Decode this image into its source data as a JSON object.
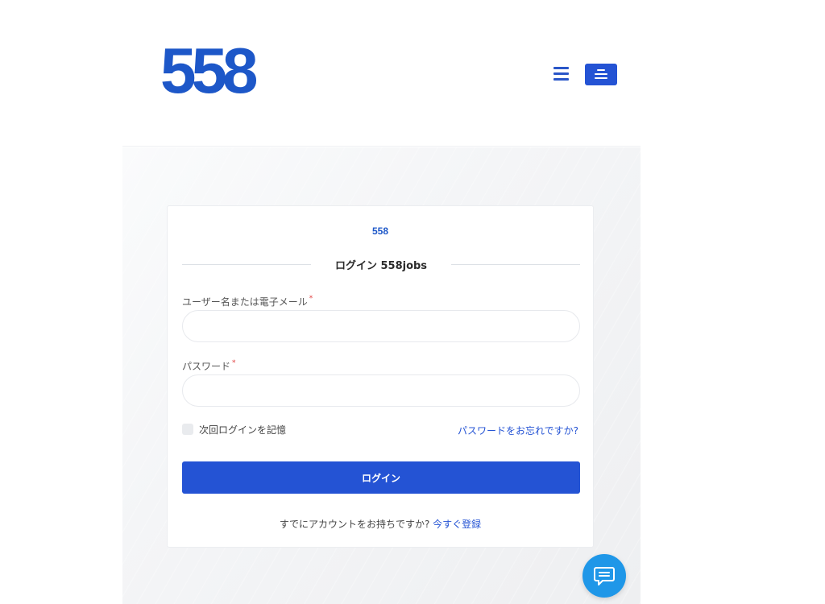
{
  "header": {
    "logo_text": "558"
  },
  "card": {
    "logo_text": "558",
    "title": "ログイン 558jobs",
    "username_label": "ユーザー名または電子メール",
    "username_value": "",
    "password_label": "パスワード",
    "password_value": "",
    "required_marker": "*",
    "remember_label": "次回ログインを記憶",
    "forgot_link": "パスワードをお忘れですか?",
    "login_button": "ログイン",
    "signup_prompt": "すでにアカウントをお持ちですか?",
    "signup_link": "今すぐ登録"
  },
  "icons": {
    "menu": "hamburger-icon",
    "menu_alt": "menu-lines-icon",
    "chat": "chat-bubble-icon"
  },
  "colors": {
    "brand": "#1d57c8",
    "primary": "#2453d4",
    "chat": "#1f97e8",
    "required": "#e03c3c"
  }
}
